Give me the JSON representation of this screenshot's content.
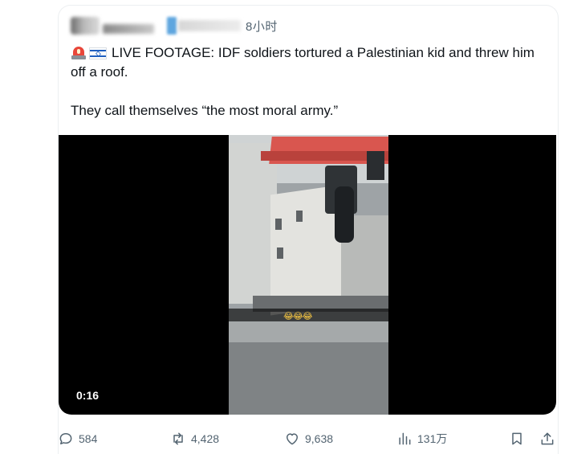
{
  "post": {
    "time": "8小时",
    "text": {
      "line1": "LIVE FOOTAGE: IDF soldiers tortured a Palestinian kid and threw him off a roof.",
      "line2": "They call themselves “the most moral army.”"
    },
    "emojis": [
      "rotating-light",
      "israel-flag"
    ]
  },
  "media": {
    "duration": "0:16",
    "caption_emojis": "😂😂😂"
  },
  "actions": {
    "replies": "584",
    "reposts": "4,428",
    "likes": "9,638",
    "views": "131万"
  },
  "colors": {
    "text": "#0f1419",
    "muted": "#536471",
    "media_bg": "#000000"
  }
}
